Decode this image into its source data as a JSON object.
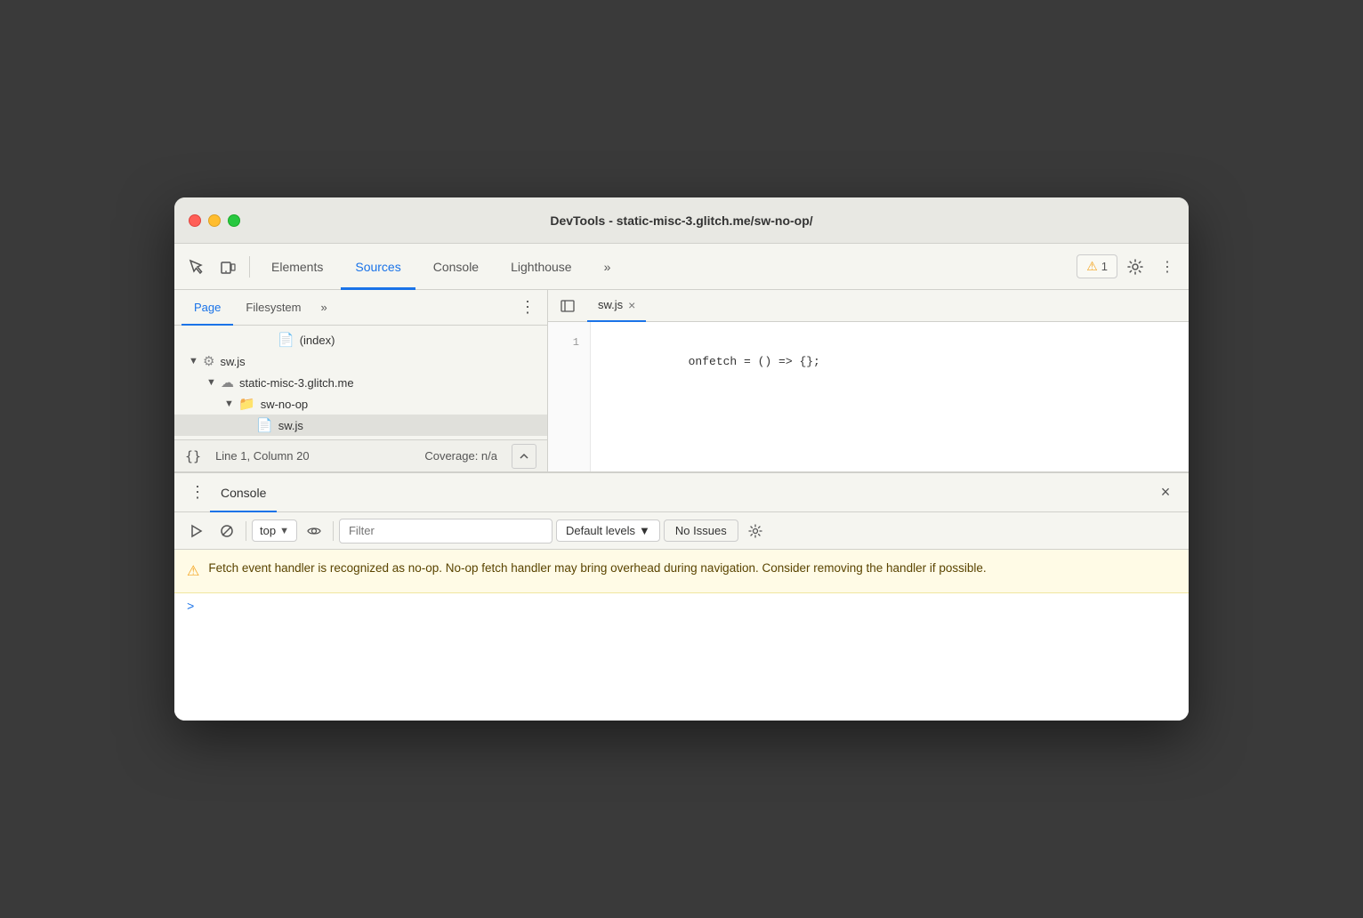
{
  "window": {
    "title": "DevTools - static-misc-3.glitch.me/sw-no-op/"
  },
  "toolbar": {
    "tabs": [
      {
        "id": "elements",
        "label": "Elements",
        "active": false
      },
      {
        "id": "sources",
        "label": "Sources",
        "active": true
      },
      {
        "id": "console",
        "label": "Console",
        "active": false
      },
      {
        "id": "lighthouse",
        "label": "Lighthouse",
        "active": false
      }
    ],
    "more_tabs_label": "»",
    "warnings_count": "1",
    "settings_label": "⚙",
    "more_options_label": "⋮"
  },
  "sources_panel": {
    "left": {
      "tabs": [
        {
          "id": "page",
          "label": "Page",
          "active": true
        },
        {
          "id": "filesystem",
          "label": "Filesystem",
          "active": false
        }
      ],
      "more_tabs": "»",
      "tree": [
        {
          "id": "index",
          "indent": 120,
          "icon": "doc",
          "label": "(index)",
          "arrow": ""
        },
        {
          "id": "swjs-root",
          "indent": 20,
          "icon": "gear",
          "label": "sw.js",
          "arrow": "▼"
        },
        {
          "id": "domain",
          "indent": 40,
          "icon": "cloud",
          "label": "static-misc-3.glitch.me",
          "arrow": "▼"
        },
        {
          "id": "folder",
          "indent": 60,
          "icon": "folder",
          "label": "sw-no-op",
          "arrow": "▼"
        },
        {
          "id": "swjs-file",
          "indent": 80,
          "icon": "jsfile",
          "label": "sw.js",
          "arrow": "",
          "selected": true
        }
      ]
    },
    "status_bar": {
      "braces": "{}",
      "position": "Line 1, Column 20",
      "coverage": "Coverage: n/a"
    },
    "right": {
      "file_tab": {
        "name": "sw.js",
        "close_label": "×"
      },
      "code": {
        "line_number": "1",
        "content": "onfetch = () => {};"
      }
    }
  },
  "console_panel": {
    "title": "Console",
    "close_label": "×",
    "toolbar": {
      "run_btn": "▶",
      "block_btn": "⊘",
      "context_label": "top",
      "context_arrow": "▼",
      "eye_label": "👁",
      "filter_placeholder": "Filter",
      "levels_label": "Default levels",
      "levels_arrow": "▼",
      "no_issues_label": "No Issues"
    },
    "warning": {
      "icon": "⚠",
      "text": "Fetch event handler is recognized as no-op. No-op fetch handler may bring overhead during navigation. Consider removing the handler if possible."
    },
    "input_prompt": ">"
  }
}
